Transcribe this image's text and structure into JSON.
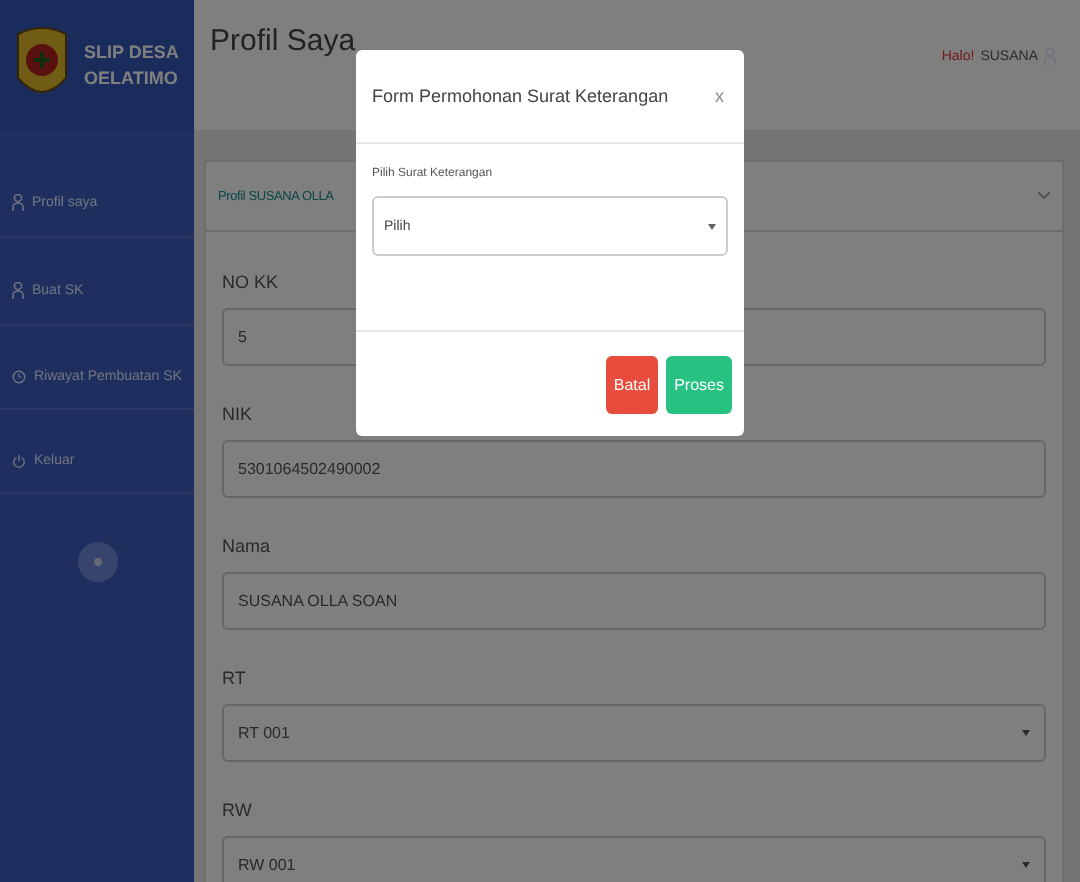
{
  "brand": {
    "line1": "SLIP DESA",
    "line2": "OELATIMO"
  },
  "sidebar": {
    "items": [
      {
        "label": "Profil saya",
        "kind": "user"
      },
      {
        "label": "Buat SK",
        "kind": "user"
      },
      {
        "label": "Riwayat Pembuatan SK",
        "kind": "clock"
      },
      {
        "label": "Keluar",
        "kind": "power"
      }
    ]
  },
  "header": {
    "title": "Profil Saya",
    "greeting": "Halo!",
    "user": "SUSANA"
  },
  "card": {
    "title": "Profil SUSANA OLLA",
    "fields": [
      {
        "label": "NO KK",
        "value": "5",
        "kind": "input"
      },
      {
        "label": "NIK",
        "value": "5301064502490002",
        "kind": "input"
      },
      {
        "label": "Nama",
        "value": "SUSANA OLLA SOAN",
        "kind": "input"
      },
      {
        "label": "RT",
        "value": "RT 001",
        "kind": "select"
      },
      {
        "label": "RW",
        "value": "RW 001",
        "kind": "select"
      }
    ]
  },
  "modal": {
    "title": "Form Permohonan Surat Keterangan",
    "close": "x",
    "field_label": "Pilih Surat Keterangan",
    "select_value": "Pilih",
    "buttons": [
      {
        "label": "Batal",
        "kind": "danger"
      },
      {
        "label": "Proses",
        "kind": "success"
      }
    ]
  }
}
